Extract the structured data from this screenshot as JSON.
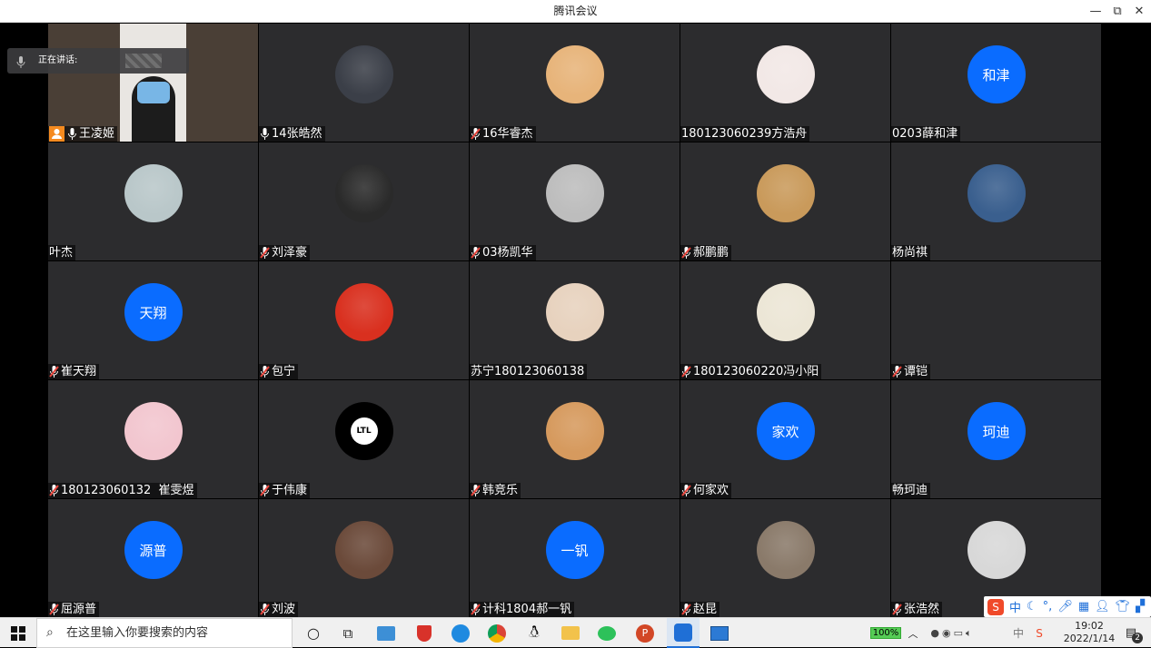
{
  "window": {
    "title": "腾讯会议",
    "minimize": "—",
    "maximize": "⧉",
    "close": "✕"
  },
  "speaking": {
    "label": "正在讲话:"
  },
  "tiles": [
    {
      "name": "王凌姬",
      "type": "video",
      "host": true,
      "mic": "on"
    },
    {
      "name": "14张皓然",
      "type": "photo",
      "mic": "on",
      "color": "#3b3f48"
    },
    {
      "name": "16华睿杰",
      "type": "photo",
      "mic": "muted",
      "color": "#e7b47a"
    },
    {
      "name": "180123060239方浩舟",
      "type": "photo",
      "mic": "none",
      "color": "#f2e8e6"
    },
    {
      "name": "0203薛和津",
      "type": "initials",
      "initials": "和津",
      "mic": "none"
    },
    {
      "name": "叶杰",
      "type": "photo",
      "mic": "none",
      "color": "#b9c7c9"
    },
    {
      "name": "刘泽豪",
      "type": "photo",
      "mic": "muted",
      "color": "#2a2a2a"
    },
    {
      "name": "03杨凯华",
      "type": "photo",
      "mic": "muted",
      "color": "#bdbdbd"
    },
    {
      "name": "郝鹏鹏",
      "type": "photo",
      "mic": "muted",
      "color": "#c99a5b"
    },
    {
      "name": "杨尚祺",
      "type": "photo",
      "mic": "none",
      "color": "#3a5f8e"
    },
    {
      "name": "崔天翔",
      "type": "initials",
      "initials": "天翔",
      "mic": "muted"
    },
    {
      "name": "包宁",
      "type": "photo",
      "mic": "muted",
      "color": "#d9301f"
    },
    {
      "name": "苏宁180123060138",
      "type": "photo",
      "mic": "none",
      "color": "#e7d2be"
    },
    {
      "name": "180123060220冯小阳",
      "type": "photo",
      "mic": "muted",
      "color": "#ece6d6"
    },
    {
      "name": "谭铠",
      "type": "empty",
      "mic": "muted"
    },
    {
      "name": "180123060132  崔雯煜",
      "type": "photo",
      "mic": "muted",
      "color": "#f2c6cf"
    },
    {
      "name": "于伟康",
      "type": "logo",
      "logo": "LTL",
      "mic": "muted"
    },
    {
      "name": "韩竞乐",
      "type": "photo",
      "mic": "muted",
      "color": "#d69a5e"
    },
    {
      "name": "何家欢",
      "type": "initials",
      "initials": "家欢",
      "mic": "muted"
    },
    {
      "name": "畅珂迪",
      "type": "initials",
      "initials": "珂迪",
      "mic": "none"
    },
    {
      "name": "屈源普",
      "type": "initials",
      "initials": "源普",
      "mic": "muted"
    },
    {
      "name": "刘波",
      "type": "photo",
      "mic": "muted",
      "color": "#6b4a3a"
    },
    {
      "name": "计科1804郝一钒",
      "type": "initials",
      "initials": "一钒",
      "mic": "muted"
    },
    {
      "name": "赵昆",
      "type": "photo",
      "mic": "muted",
      "color": "#8a7a6a"
    },
    {
      "name": "张浩然",
      "type": "photo",
      "mic": "muted",
      "color": "#d8d8d8"
    }
  ],
  "taskbar": {
    "search_placeholder": "在这里输入你要搜索的内容",
    "battery": "100%",
    "time": "19:02",
    "date": "2022/1/14",
    "notifications": "2"
  },
  "ime": {
    "mode": "中"
  }
}
